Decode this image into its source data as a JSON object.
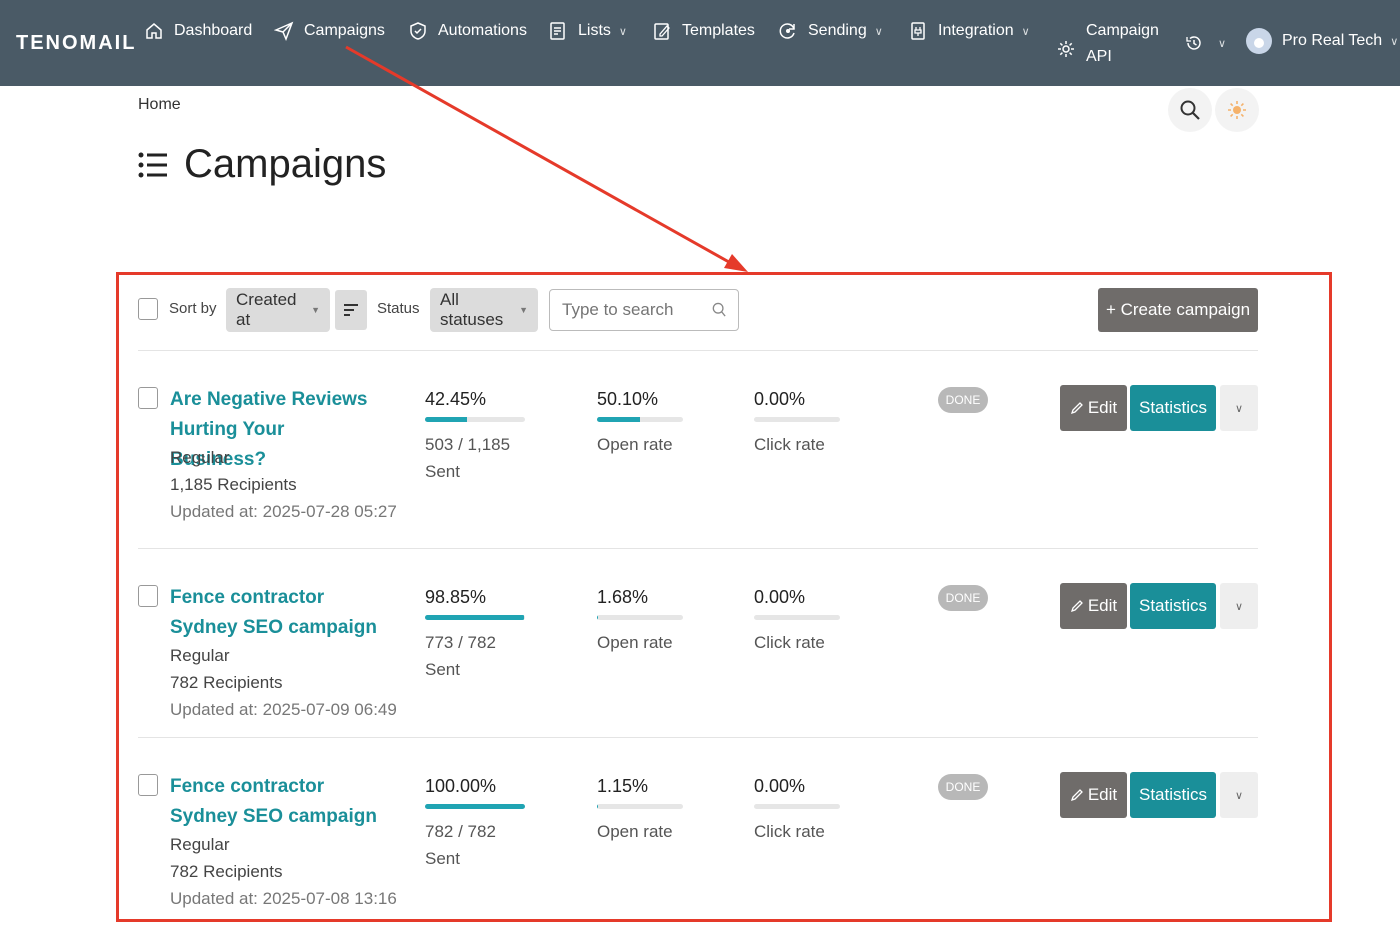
{
  "nav": {
    "brand": "TENOMAIL",
    "items": [
      {
        "label": "Dashboard",
        "icon": "home-icon"
      },
      {
        "label": "Campaigns",
        "icon": "paper-plane-icon"
      },
      {
        "label": "Automations",
        "icon": "shield-check-icon"
      },
      {
        "label": "Lists",
        "icon": "list-doc-icon"
      },
      {
        "label": "Templates",
        "icon": "edit-doc-icon"
      },
      {
        "label": "Sending",
        "icon": "refresh-icon"
      },
      {
        "label": "Integration",
        "icon": "plug-doc-icon"
      }
    ],
    "campaign_api": {
      "line1": "Campaign",
      "line2": "API",
      "icon": "gear-icon"
    },
    "history_icon": "history-icon",
    "user_name": "Pro Real Tech"
  },
  "breadcrumb": "Home",
  "page_title": "Campaigns",
  "toolbar": {
    "sort_by_label": "Sort by",
    "sort_value": "Created at",
    "status_label": "Status",
    "status_value": "All statuses",
    "search_placeholder": "Type to search",
    "create_label": "+ Create campaign"
  },
  "campaigns": [
    {
      "name": "Are Negative Reviews Hurting Your Business?",
      "type": "Regular",
      "recipients": "1,185 Recipients",
      "updated": "Updated at: 2025-07-28 05:27",
      "sent_pct": "42.45%",
      "sent_fraction": 0.4245,
      "sent_count": "503 / 1,185",
      "sent_label": "Sent",
      "open_pct": "50.10%",
      "open_fraction": 0.501,
      "open_label": "Open rate",
      "click_pct": "0.00%",
      "click_fraction": 0.0,
      "click_label": "Click rate",
      "status": "DONE",
      "edit_label": "Edit",
      "stats_label": "Statistics"
    },
    {
      "name": "Fence contractor Sydney SEO campaign",
      "type": "Regular",
      "recipients": "782 Recipients",
      "updated": "Updated at: 2025-07-09 06:49",
      "sent_pct": "98.85%",
      "sent_fraction": 0.9885,
      "sent_count": "773 / 782",
      "sent_label": "Sent",
      "open_pct": "1.68%",
      "open_fraction": 0.0168,
      "open_label": "Open rate",
      "click_pct": "0.00%",
      "click_fraction": 0.0,
      "click_label": "Click rate",
      "status": "DONE",
      "edit_label": "Edit",
      "stats_label": "Statistics"
    },
    {
      "name": "Fence contractor Sydney SEO campaign",
      "type": "Regular",
      "recipients": "782 Recipients",
      "updated": "Updated at: 2025-07-08 13:16",
      "sent_pct": "100.00%",
      "sent_fraction": 1.0,
      "sent_count": "782 / 782",
      "sent_label": "Sent",
      "open_pct": "1.15%",
      "open_fraction": 0.0115,
      "open_label": "Open rate",
      "click_pct": "0.00%",
      "click_fraction": 0.0,
      "click_label": "Click rate",
      "status": "DONE",
      "edit_label": "Edit",
      "stats_label": "Statistics"
    }
  ],
  "colors": {
    "nav_bg": "#4a5a66",
    "accent": "#1a8f99",
    "bar_fill": "#20a4b3",
    "annotation": "#e53a2a",
    "edit_btn": "#6f6c6a"
  }
}
